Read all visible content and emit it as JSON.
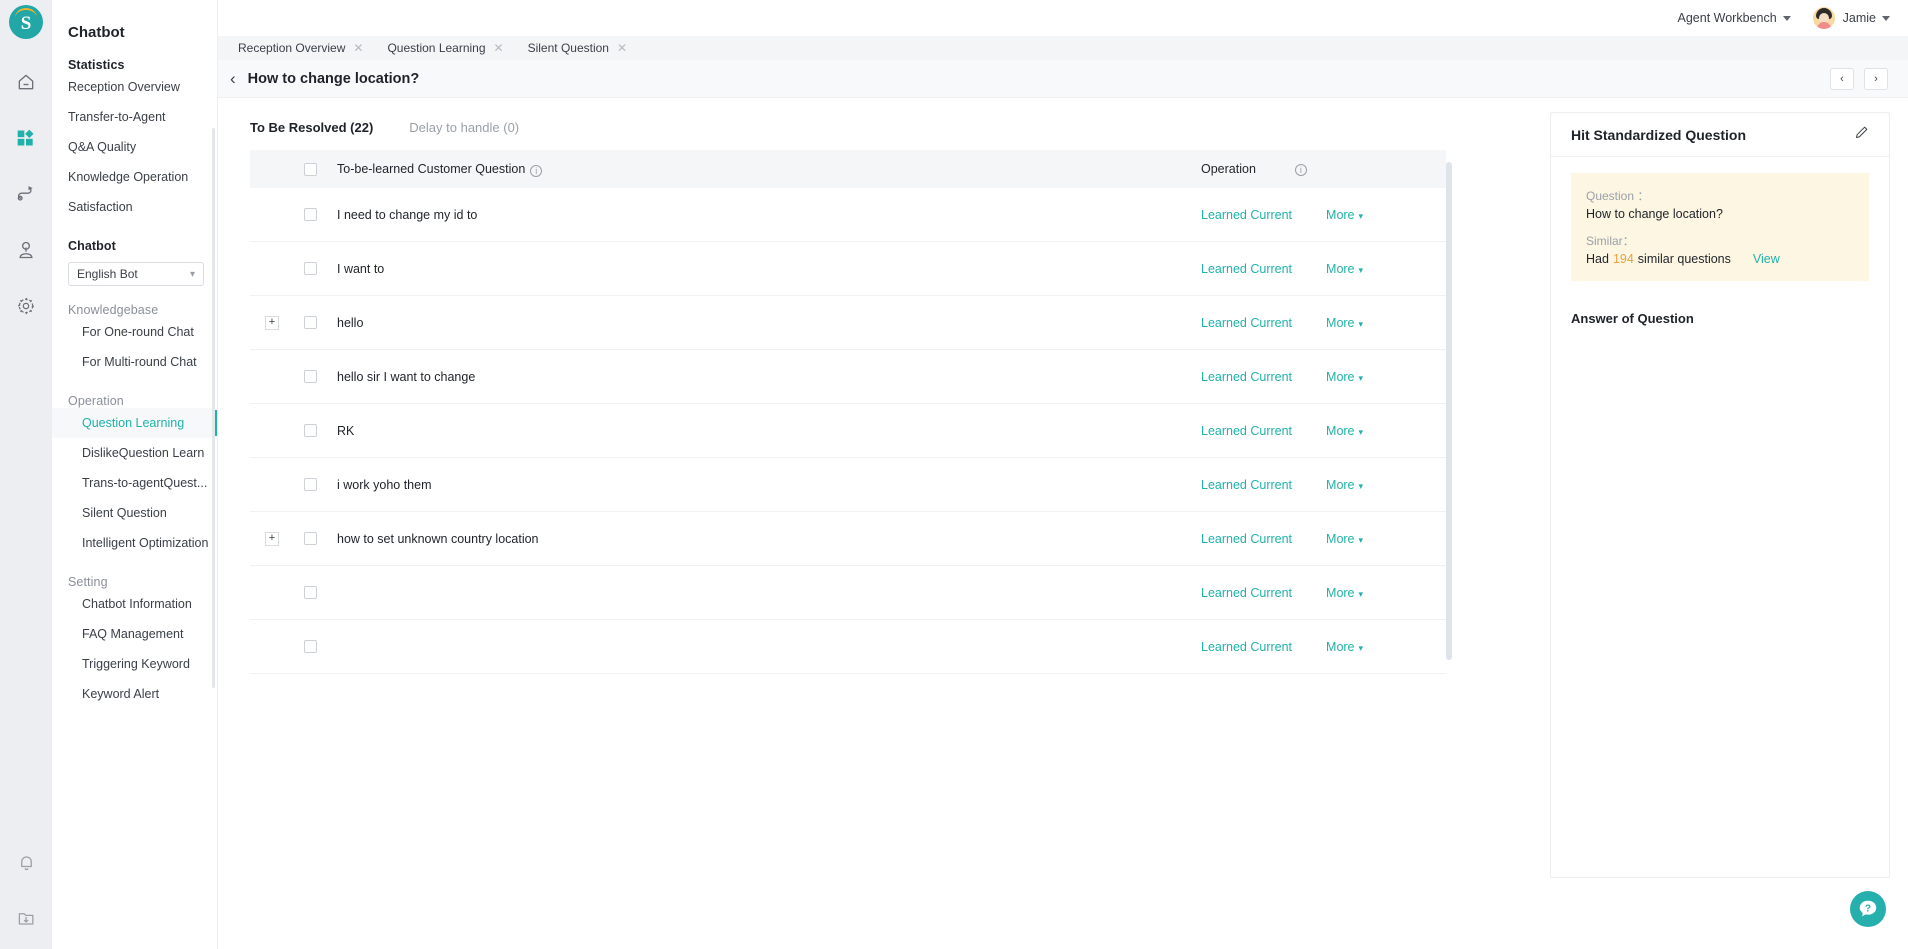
{
  "rail": {
    "logo_letter": "S",
    "icons": [
      {
        "name": "home-icon"
      },
      {
        "name": "dashboard-grid-icon"
      },
      {
        "name": "flow-route-icon"
      },
      {
        "name": "user-profile-icon"
      },
      {
        "name": "gear-settings-icon"
      }
    ],
    "bottom_icons": [
      {
        "name": "bell-notification-icon"
      },
      {
        "name": "download-folder-icon"
      }
    ],
    "accent": "#20b2aa"
  },
  "topbar": {
    "workbench_label": "Agent Workbench",
    "user_name": "Jamie"
  },
  "tabs": [
    {
      "label": "Reception Overview"
    },
    {
      "label": "Question Learning"
    },
    {
      "label": "Silent Question"
    }
  ],
  "sidebar": {
    "title": "Chatbot",
    "groups": [
      {
        "label": "Statistics",
        "bold": true,
        "items": [
          {
            "label": "Reception Overview",
            "active": false
          },
          {
            "label": "Transfer-to-Agent",
            "active": false
          },
          {
            "label": "Q&A Quality",
            "active": false
          },
          {
            "label": "Knowledge Operation",
            "active": false
          },
          {
            "label": "Satisfaction",
            "active": false
          }
        ]
      },
      {
        "label": "Chatbot",
        "bold": true,
        "select": {
          "value": "English Bot"
        },
        "items": []
      },
      {
        "label": "Knowledgebase",
        "bold": false,
        "items": [
          {
            "label": "For One-round Chat",
            "active": false
          },
          {
            "label": "For Multi-round Chat",
            "active": false
          }
        ]
      },
      {
        "label": "Operation",
        "bold": false,
        "items": [
          {
            "label": "Question Learning",
            "active": true
          },
          {
            "label": "DislikeQuestion Learn",
            "active": false
          },
          {
            "label": "Trans-to-agentQuest...",
            "active": false
          },
          {
            "label": "Silent Question",
            "active": false
          },
          {
            "label": "Intelligent Optimization",
            "active": false
          }
        ]
      },
      {
        "label": "Setting",
        "bold": false,
        "items": [
          {
            "label": "Chatbot Information",
            "active": false
          },
          {
            "label": "FAQ Management",
            "active": false
          },
          {
            "label": "Triggering Keyword",
            "active": false
          },
          {
            "label": "Keyword Alert",
            "active": false
          }
        ]
      }
    ]
  },
  "page": {
    "title": "How to change location?",
    "prev_label": "‹",
    "next_label": "›"
  },
  "content_tabs": [
    {
      "label": "To Be Resolved (22)",
      "active": true
    },
    {
      "label": "Delay to handle (0)",
      "active": false
    }
  ],
  "table": {
    "headers": {
      "question": "To-be-learned Customer Question",
      "operation": "Operation"
    },
    "rows": [
      {
        "question": "I need to change my id to",
        "expandable": false,
        "learned": "Learned Current",
        "more": "More"
      },
      {
        "question": "I want to",
        "expandable": false,
        "learned": "Learned Current",
        "more": "More"
      },
      {
        "question": "hello",
        "expandable": true,
        "learned": "Learned Current",
        "more": "More"
      },
      {
        "question": "hello sir I want to change",
        "expandable": false,
        "learned": "Learned Current",
        "more": "More"
      },
      {
        "question": "RK",
        "expandable": false,
        "learned": "Learned Current",
        "more": "More"
      },
      {
        "question": "i work yoho them",
        "expandable": false,
        "learned": "Learned Current",
        "more": "More"
      },
      {
        "question": "how to set unknown country location",
        "expandable": true,
        "learned": "Learned Current",
        "more": "More"
      },
      {
        "question": "",
        "expandable": false,
        "learned": "Learned Current",
        "more": "More"
      },
      {
        "question": "",
        "expandable": false,
        "learned": "Learned Current",
        "more": "More"
      }
    ]
  },
  "side_panel": {
    "title": "Hit Standardized Question",
    "edit_icon": "pencil-edit-icon",
    "question_label": "Question ：",
    "question_value": "How to change location?",
    "similar_label": "Similar：",
    "similar_prefix": "Had",
    "similar_count": "194",
    "similar_suffix": "similar questions",
    "view_label": "View",
    "answer_title": "Answer of Question"
  },
  "help": {
    "glyph": "?"
  }
}
